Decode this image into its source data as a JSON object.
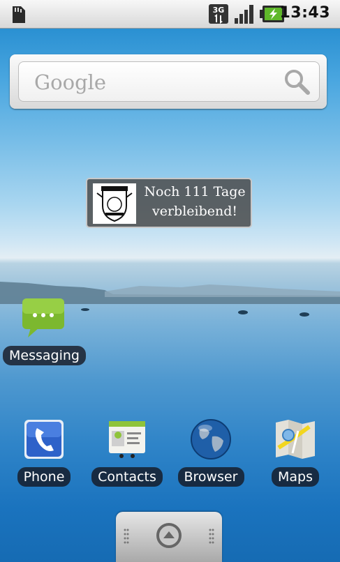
{
  "status_bar": {
    "time": "13:43",
    "network_label": "3G",
    "icons": [
      "sd-card-icon",
      "3g-data-icon",
      "signal-strength-icon",
      "battery-charging-icon"
    ]
  },
  "search": {
    "logo_text": "Google",
    "icons": [
      "search-icon"
    ]
  },
  "countdown_widget": {
    "line1": "Noch 111 Tage",
    "line2": "verbleibend!"
  },
  "shortcuts": [
    {
      "label": "Messaging",
      "icon": "messaging-icon"
    }
  ],
  "dock": [
    {
      "label": "Phone",
      "icon": "phone-icon"
    },
    {
      "label": "Contacts",
      "icon": "contacts-icon"
    },
    {
      "label": "Browser",
      "icon": "browser-globe-icon"
    },
    {
      "label": "Maps",
      "icon": "maps-icon"
    }
  ],
  "launcher": {
    "icon": "launcher-arrow-up-icon"
  },
  "colors": {
    "status_bar": "#e6e6e6",
    "battery_accent": "#5fb82a",
    "label_bg": "#14141e",
    "widget_bg": "#4b4b4b"
  }
}
